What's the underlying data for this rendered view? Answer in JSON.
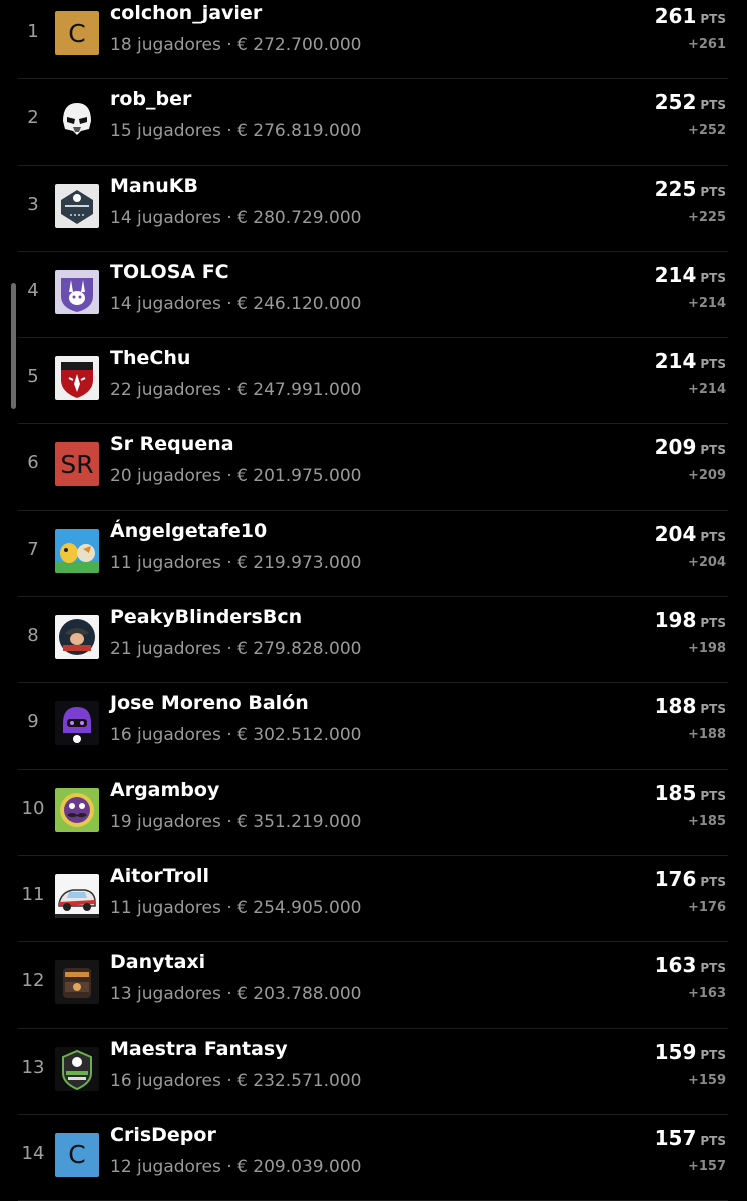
{
  "leaderboard": {
    "pts_unit": "PTS",
    "rows": [
      {
        "rank": "1",
        "name": "colchon_javier",
        "meta": "18 jugadores · € 272.700.000",
        "points": "261",
        "delta": "+261",
        "avatar_letter": "C",
        "avatar_color": "#c9953f"
      },
      {
        "rank": "2",
        "name": "rob_ber",
        "meta": "15 jugadores · € 276.819.000",
        "points": "252",
        "delta": "+252",
        "avatar_icon": "stormtrooper-helmet-icon"
      },
      {
        "rank": "3",
        "name": "ManuKB",
        "meta": "14 jugadores · € 280.729.000",
        "points": "225",
        "delta": "+225",
        "avatar_icon": "football-shield-crest-icon"
      },
      {
        "rank": "4",
        "name": "TOLOSA FC",
        "meta": "14 jugadores · € 246.120.000",
        "points": "214",
        "delta": "+214",
        "avatar_icon": "purple-rabbit-crest-icon"
      },
      {
        "rank": "5",
        "name": "TheChu",
        "meta": "22 jugadores · € 247.991.000",
        "points": "214",
        "delta": "+214",
        "avatar_icon": "red-club-crest-icon"
      },
      {
        "rank": "6",
        "name": "Sr Requena",
        "meta": "20 jugadores · € 201.975.000",
        "points": "209",
        "delta": "+209",
        "avatar_letter": "SR",
        "avatar_color": "#c8463c"
      },
      {
        "rank": "7",
        "name": "Ángelgetafe10",
        "meta": "11 jugadores · € 219.973.000",
        "points": "204",
        "delta": "+204",
        "avatar_icon": "cartoon-characters-icon"
      },
      {
        "rank": "8",
        "name": "PeakyBlindersBcn",
        "meta": "21 jugadores · € 279.828.000",
        "points": "198",
        "delta": "+198",
        "avatar_icon": "peaky-blinders-badge-icon"
      },
      {
        "rank": "9",
        "name": "Jose Moreno Balón",
        "meta": "16 jugadores · € 302.512.000",
        "points": "188",
        "delta": "+188",
        "avatar_icon": "purple-helmet-jmb-icon"
      },
      {
        "rank": "10",
        "name": "Argamboy",
        "meta": "19 jugadores · € 351.219.000",
        "points": "185",
        "delta": "+185",
        "avatar_icon": "green-mustache-face-icon"
      },
      {
        "rank": "11",
        "name": "AitorTroll",
        "meta": "11 jugadores · € 254.905.000",
        "points": "176",
        "delta": "+176",
        "avatar_icon": "cartoon-car-icon"
      },
      {
        "rank": "12",
        "name": "Danytaxi",
        "meta": "13 jugadores · € 203.788.000",
        "points": "163",
        "delta": "+163",
        "avatar_icon": "dark-club-crest-icon"
      },
      {
        "rank": "13",
        "name": "Maestra Fantasy",
        "meta": "16 jugadores · € 232.571.000",
        "points": "159",
        "delta": "+159",
        "avatar_icon": "maestra-fantasy-badge-icon"
      },
      {
        "rank": "14",
        "name": "CrisDepor",
        "meta": "12 jugadores · € 209.039.000",
        "points": "157",
        "delta": "+157",
        "avatar_letter": "C",
        "avatar_color": "#4a9ad6"
      }
    ]
  }
}
